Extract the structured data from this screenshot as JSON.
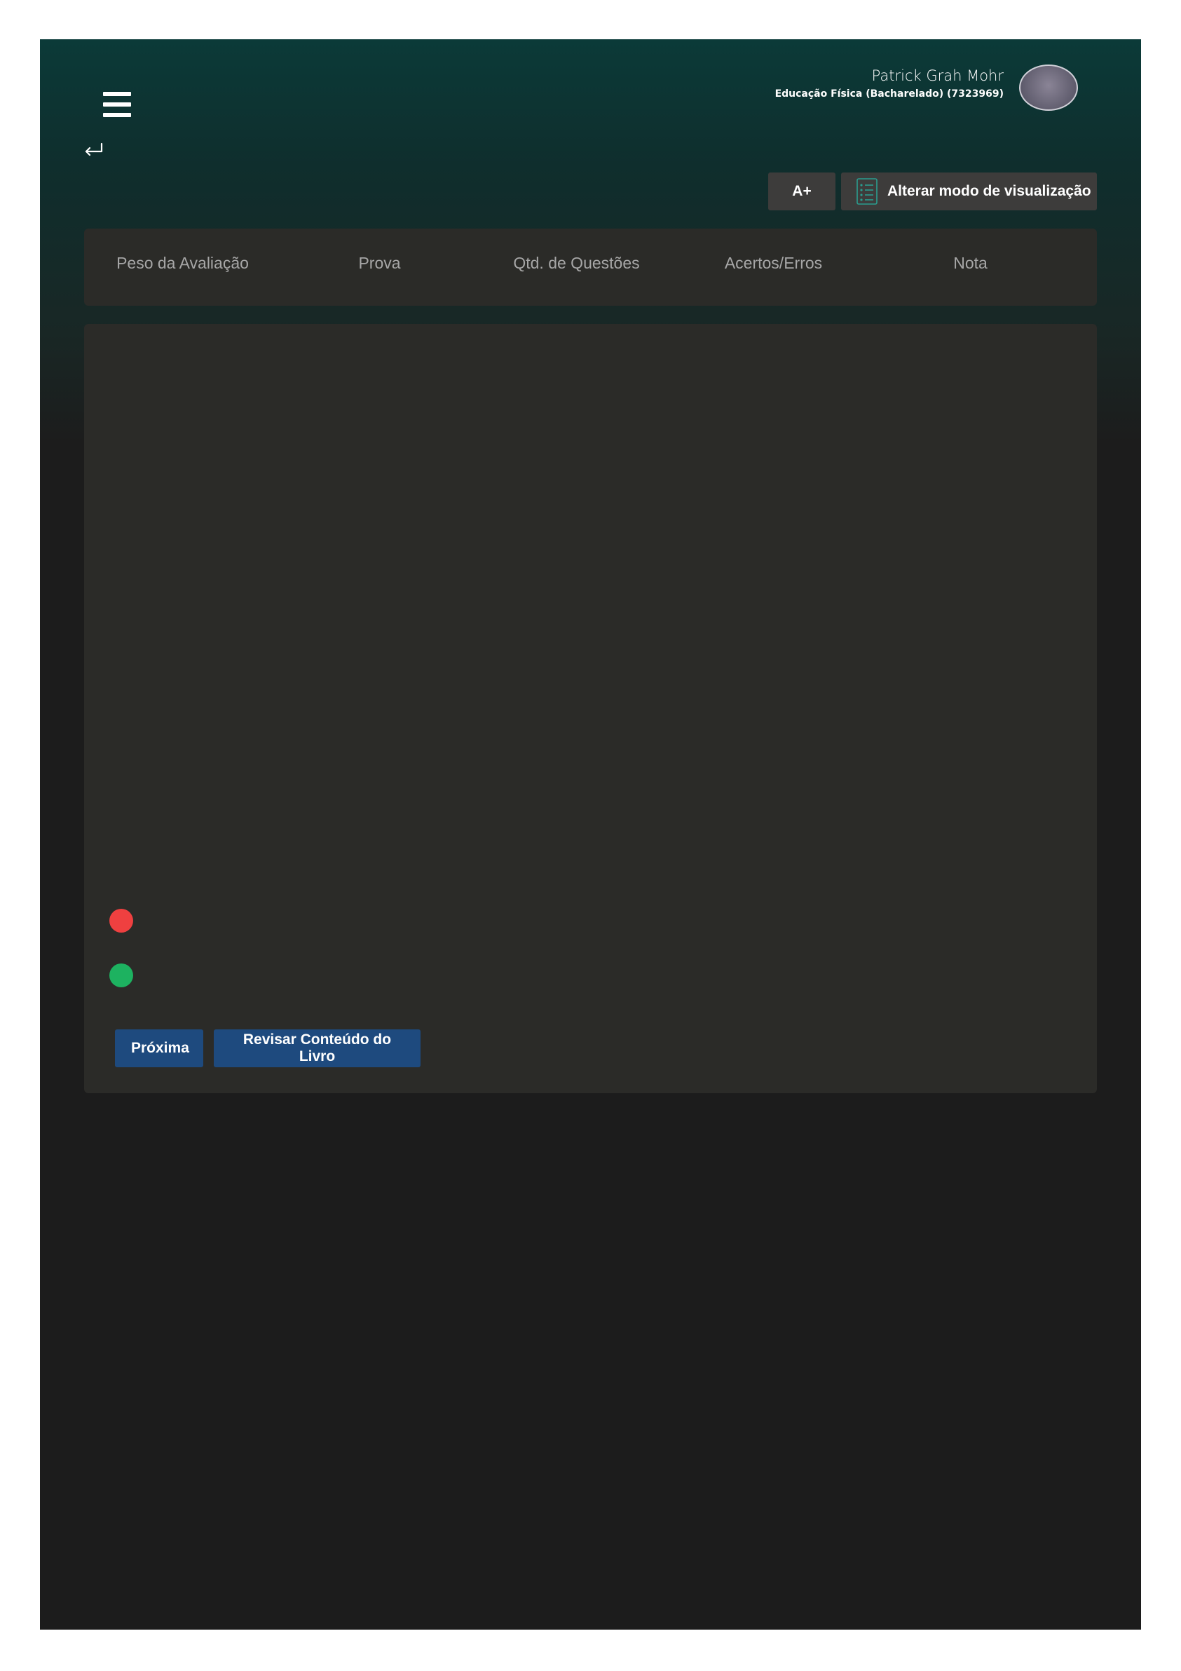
{
  "header": {
    "user_name": "Patrick Grah Mohr",
    "user_course": "Educação Física (Bacharelado) (7323969)"
  },
  "toolbar": {
    "font_increase_label": "A+",
    "view_mode_label": "Alterar modo de visualização"
  },
  "table": {
    "columns": [
      "Peso da Avaliação",
      "Prova",
      "Qtd. de Questões",
      "Acertos/Erros",
      "Nota"
    ]
  },
  "legend": {
    "wrong_color": "#ef4040",
    "correct_color": "#1db260"
  },
  "actions": {
    "next_label": "Próxima",
    "review_label": "Revisar Conteúdo do Livro"
  },
  "icons": {
    "menu": "menu-icon",
    "back": "back-arrow-icon",
    "view_mode": "list-view-icon"
  },
  "colors": {
    "header_gradient_top": "#0b3a38",
    "background": "#1c1c1c",
    "panel": "#2b2b28",
    "primary_button": "#1e4a7e"
  }
}
